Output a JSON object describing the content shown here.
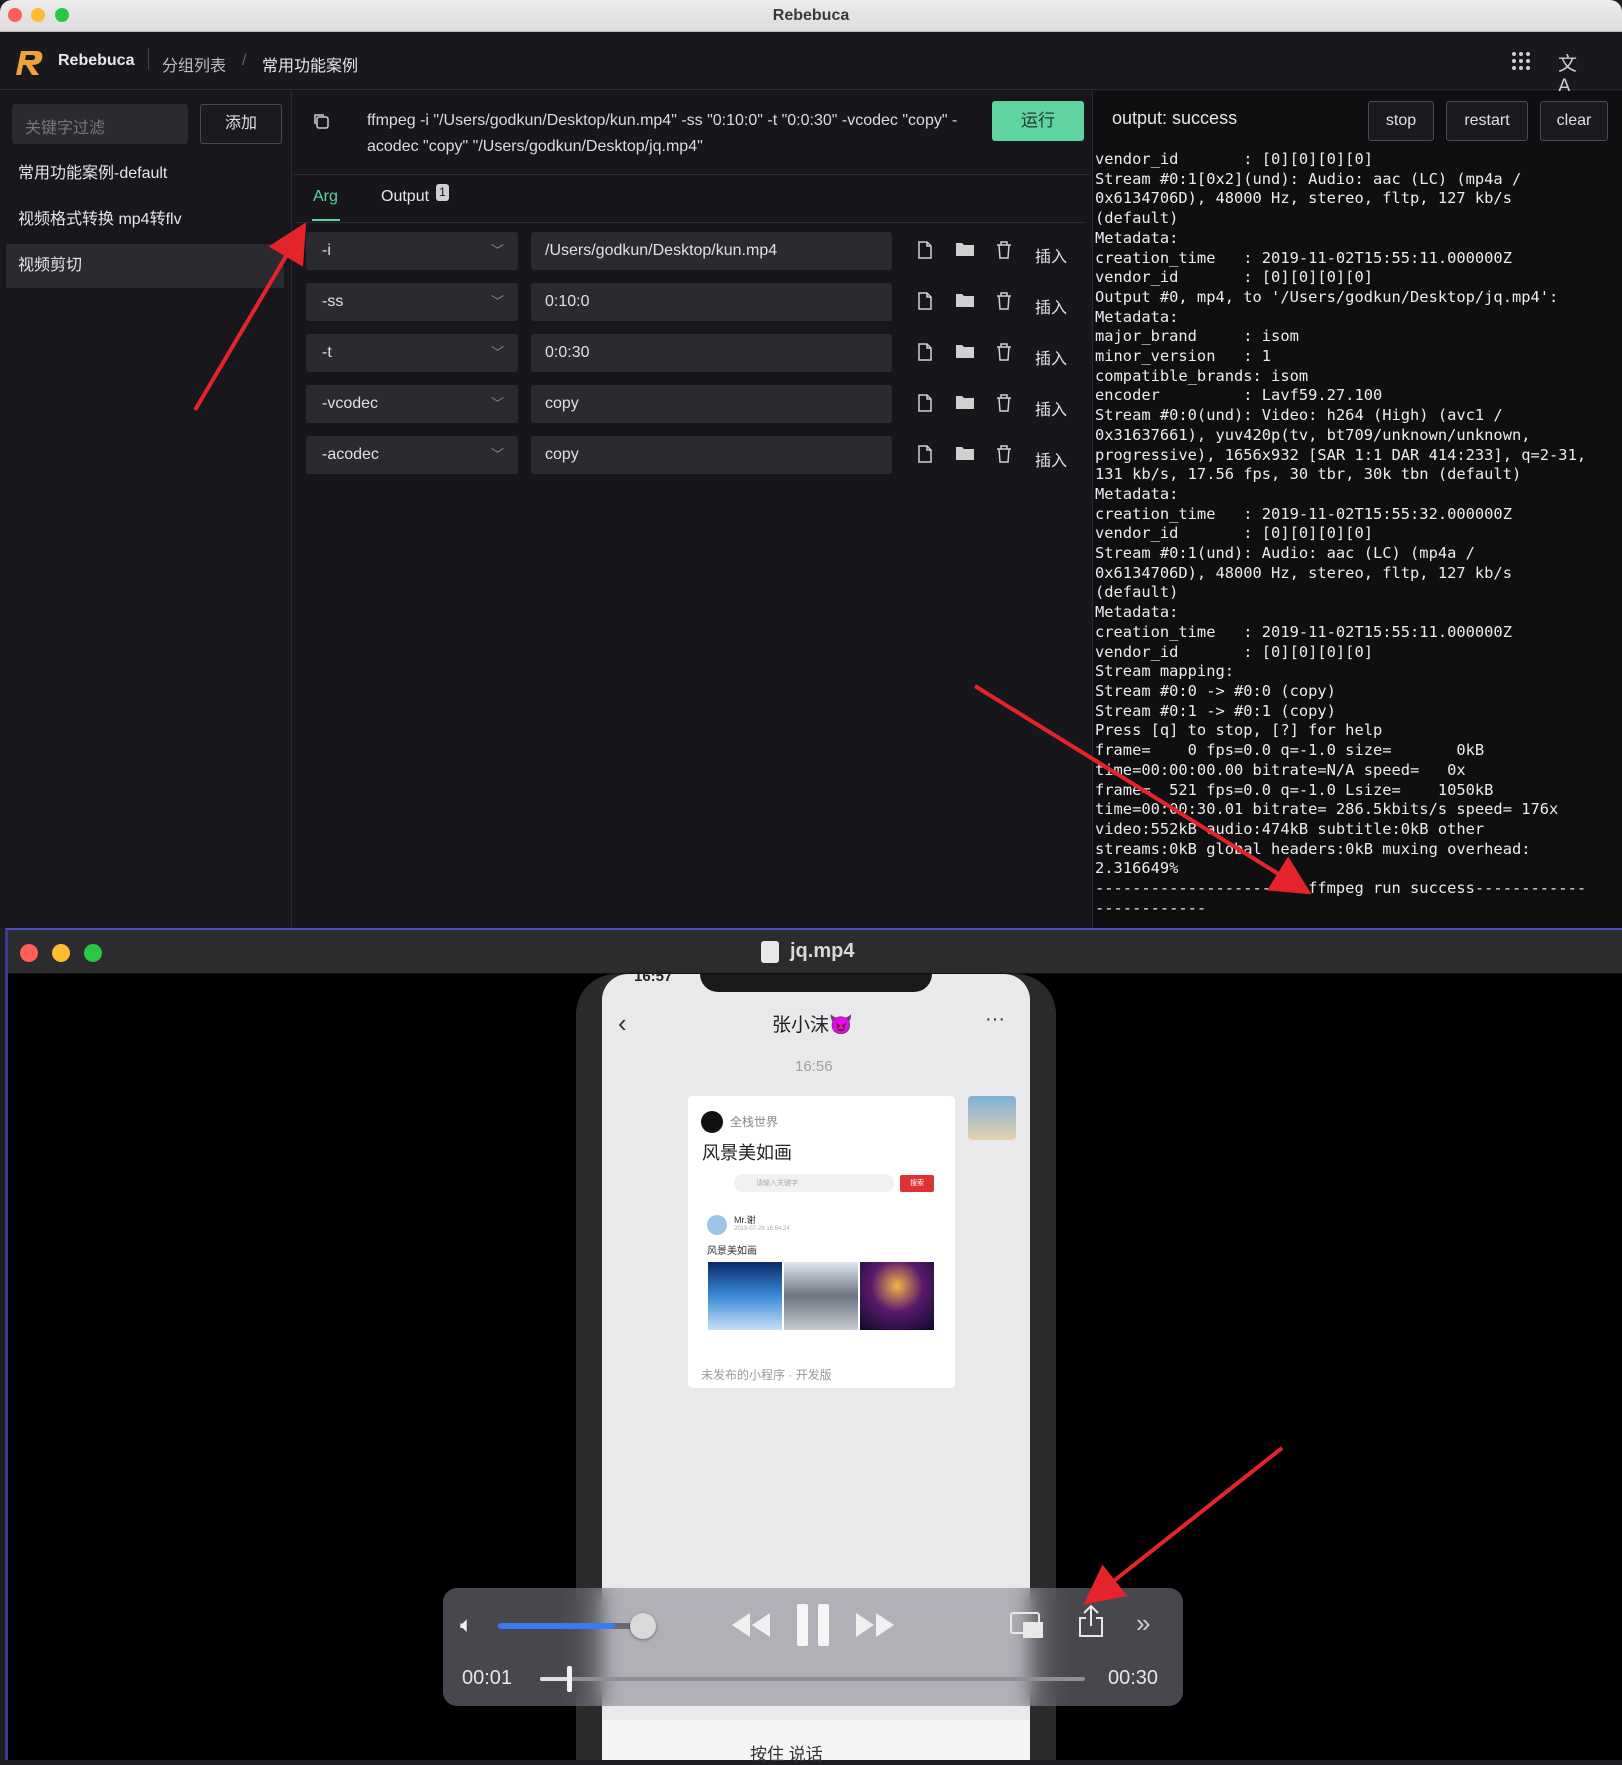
{
  "window1": {
    "title": "Rebebuca",
    "brand": "Rebebuca",
    "breadcrumb": [
      "分组列表",
      "/",
      "常用功能案例"
    ],
    "icons": [
      "grid-icon",
      "translate-icon"
    ]
  },
  "sidebar": {
    "filter_placeholder": "关键字过滤",
    "add_label": "添加",
    "items": [
      {
        "label": "常用功能案例-default",
        "active": false
      },
      {
        "label": "视频格式转换 mp4转flv",
        "active": false
      },
      {
        "label": "视频剪切",
        "active": true
      }
    ]
  },
  "command": {
    "text": "ffmpeg  -i \"/Users/godkun/Desktop/kun.mp4\" -ss \"0:10:0\" -t \"0:0:30\" -vcodec \"copy\" -acodec \"copy\"  \"/Users/godkun/Desktop/jq.mp4\"",
    "run_label": "运行"
  },
  "tabs": {
    "arg": "Arg",
    "output": "Output",
    "output_badge": "1"
  },
  "args": [
    {
      "flag": "-i",
      "value": "/Users/godkun/Desktop/kun.mp4",
      "insert": "插入"
    },
    {
      "flag": "-ss",
      "value": "0:10:0",
      "insert": "插入"
    },
    {
      "flag": "-t",
      "value": "0:0:30",
      "insert": "插入"
    },
    {
      "flag": "-vcodec",
      "value": "copy",
      "insert": "插入"
    },
    {
      "flag": "-acodec",
      "value": "copy",
      "insert": "插入"
    }
  ],
  "output": {
    "status": "output: success",
    "stop": "stop",
    "restart": "restart",
    "clear": "clear",
    "log": [
      "vendor_id       : [0][0][0][0]",
      "Stream #0:1[0x2](und): Audio: aac (LC) (mp4a /",
      "0x6134706D), 48000 Hz, stereo, fltp, 127 kb/s",
      "(default)",
      "Metadata:",
      "creation_time   : 2019-11-02T15:55:11.000000Z",
      "vendor_id       : [0][0][0][0]",
      "Output #0, mp4, to '/Users/godkun/Desktop/jq.mp4':",
      "Metadata:",
      "major_brand     : isom",
      "minor_version   : 1",
      "compatible_brands: isom",
      "encoder         : Lavf59.27.100",
      "Stream #0:0(und): Video: h264 (High) (avc1 /",
      "0x31637661), yuv420p(tv, bt709/unknown/unknown,",
      "progressive), 1656x932 [SAR 1:1 DAR 414:233], q=2-31,",
      "131 kb/s, 17.56 fps, 30 tbr, 30k tbn (default)",
      "Metadata:",
      "creation_time   : 2019-11-02T15:55:32.000000Z",
      "vendor_id       : [0][0][0][0]",
      "Stream #0:1(und): Audio: aac (LC) (mp4a /",
      "0x6134706D), 48000 Hz, stereo, fltp, 127 kb/s",
      "(default)",
      "Metadata:",
      "creation_time   : 2019-11-02T15:55:11.000000Z",
      "vendor_id       : [0][0][0][0]",
      "Stream mapping:",
      "Stream #0:0 -> #0:0 (copy)",
      "Stream #0:1 -> #0:1 (copy)",
      "Press [q] to stop, [?] for help",
      "frame=    0 fps=0.0 q=-1.0 size=       0kB",
      "time=00:00:00.00 bitrate=N/A speed=   0x",
      "frame=  521 fps=0.0 q=-1.0 Lsize=    1050kB",
      "time=00:00:30.01 bitrate= 286.5kbits/s speed= 176x",
      "video:552kB audio:474kB subtitle:0kB other",
      "streams:0kB global headers:0kB muxing overhead:",
      "2.316649%",
      "-----------------------ffmpeg run success------------",
      "------------"
    ]
  },
  "player": {
    "title": "jq.mp4",
    "current_time": "00:01",
    "duration": "00:30",
    "volume": 0.85,
    "progress": 0.04
  },
  "phone": {
    "status_time": "16:57",
    "contact": "张小沫😈",
    "msg_time": "16:56",
    "card_source": "全栈世界",
    "card_title": "风景美如画",
    "search_placeholder": "请输入关键字",
    "search_btn": "搜索",
    "post_user": "Mr.谢",
    "post_date": "2019-07-28 16:54:24",
    "post_title": "风景美如画",
    "card_footer": "未发布的小程序 · 开发版",
    "voice_btn": "按住 说话"
  }
}
